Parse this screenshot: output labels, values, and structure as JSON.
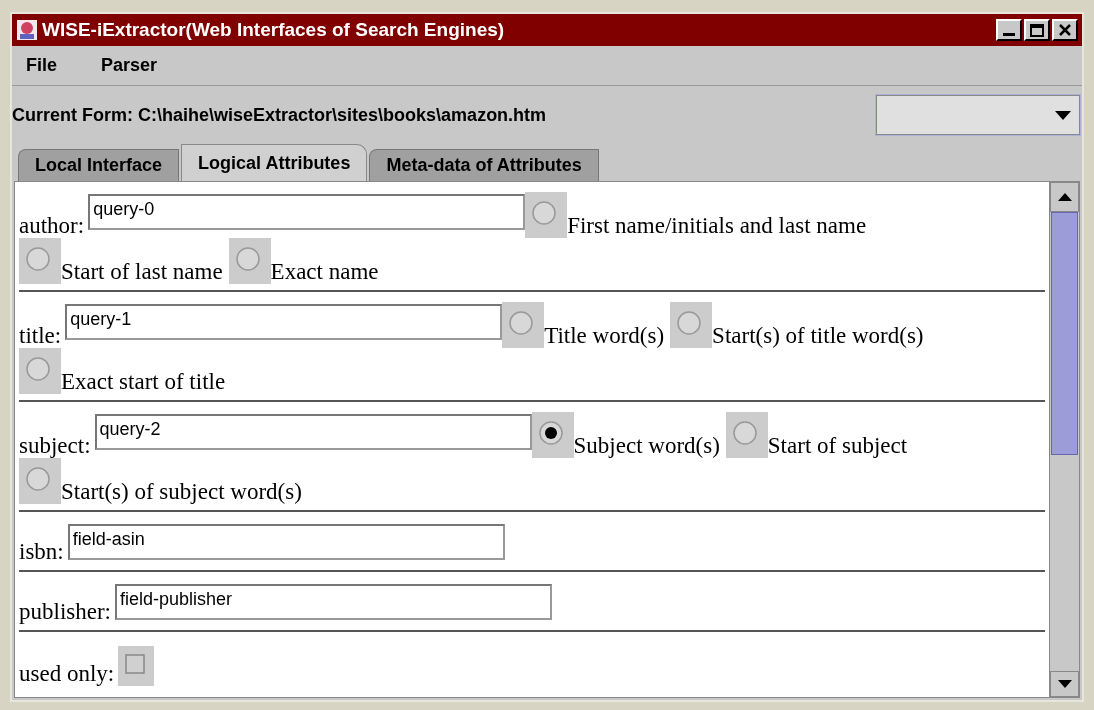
{
  "window": {
    "title": "WISE-iExtractor(Web Interfaces of Search Engines)"
  },
  "menu": [
    "File",
    "Parser"
  ],
  "current_form": "Current Form: C:\\haihe\\wiseExtractor\\sites\\books\\amazon.htm",
  "tabs": [
    {
      "label": "Local Interface",
      "selected": false
    },
    {
      "label": "Logical Attributes",
      "selected": true
    },
    {
      "label": "Meta-data of Attributes",
      "selected": false
    }
  ],
  "attributes": [
    {
      "kind": "text",
      "label": "author:",
      "value": "query-0",
      "options": [
        {
          "label": "First name/initials and last name",
          "selected": false
        },
        {
          "label": "Start of last name",
          "selected": false
        },
        {
          "label": "Exact name",
          "selected": false
        }
      ]
    },
    {
      "kind": "text",
      "label": "title:",
      "value": "query-1",
      "options": [
        {
          "label": "Title word(s)",
          "selected": false
        },
        {
          "label": "Start(s) of title word(s)",
          "selected": false
        },
        {
          "label": "Exact start of title",
          "selected": false
        }
      ]
    },
    {
      "kind": "text",
      "label": "subject:",
      "value": "query-2",
      "options": [
        {
          "label": "Subject word(s)",
          "selected": true
        },
        {
          "label": "Start of subject",
          "selected": false
        },
        {
          "label": "Start(s) of subject word(s)",
          "selected": false
        }
      ]
    },
    {
      "kind": "text",
      "label": "isbn:",
      "value": "field-asin"
    },
    {
      "kind": "text",
      "label": "publisher:",
      "value": "field-publisher"
    },
    {
      "kind": "checkbox",
      "label": "used only:",
      "checked": false
    }
  ]
}
